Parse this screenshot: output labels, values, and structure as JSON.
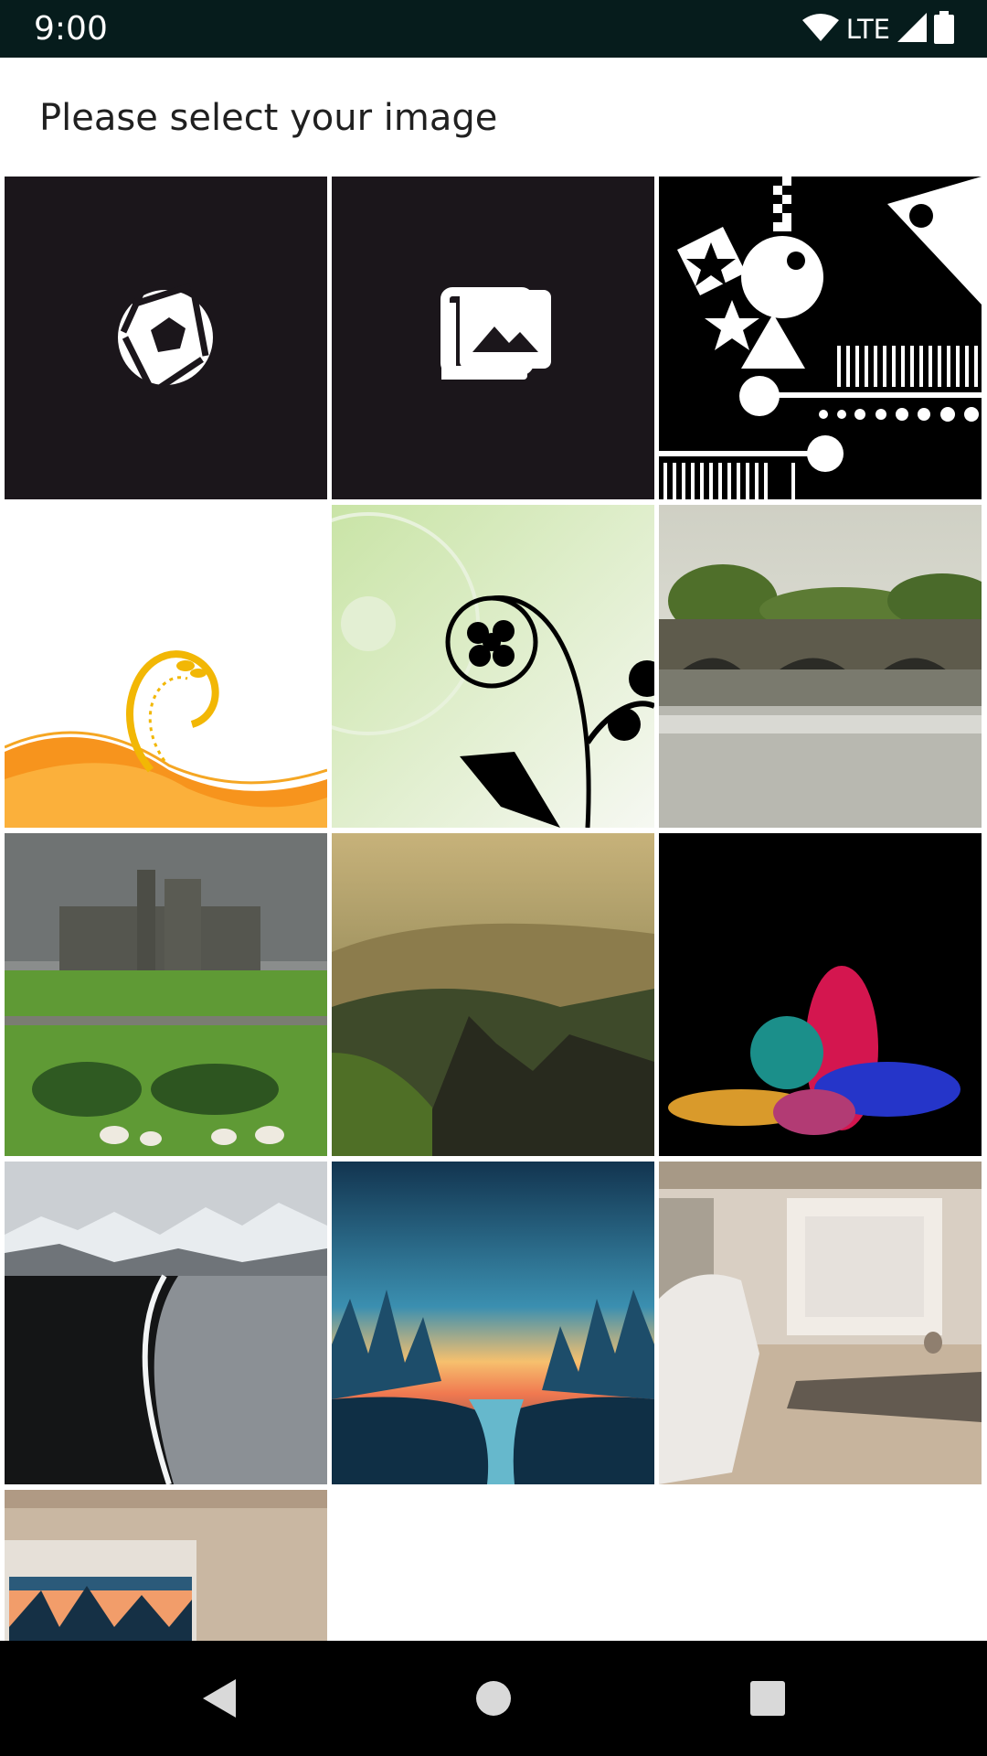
{
  "status_bar": {
    "time": "9:00",
    "network_label": "LTE",
    "icons": [
      "wifi-icon",
      "cell-signal-icon",
      "battery-icon"
    ]
  },
  "header": {
    "title": "Please select your image"
  },
  "grid": {
    "items": [
      {
        "kind": "action",
        "icon": "camera-shutter-icon",
        "name": "camera-tile"
      },
      {
        "kind": "action",
        "icon": "photo-library-icon",
        "name": "gallery-tile"
      },
      {
        "kind": "image",
        "name": "image-geometric-shapes"
      },
      {
        "kind": "image",
        "name": "image-orange-swirl"
      },
      {
        "kind": "image",
        "name": "image-floral-swirl"
      },
      {
        "kind": "image",
        "name": "image-stone-bridge"
      },
      {
        "kind": "image",
        "name": "image-castle-sheep"
      },
      {
        "kind": "image",
        "name": "image-mountain-valley"
      },
      {
        "kind": "image",
        "name": "image-color-powder"
      },
      {
        "kind": "image",
        "name": "image-black-beach"
      },
      {
        "kind": "image",
        "name": "image-forest-sunset"
      },
      {
        "kind": "image",
        "name": "image-room-dog"
      },
      {
        "kind": "image",
        "name": "image-room-painting"
      }
    ]
  },
  "colors": {
    "status_bar": "#061c1c",
    "action_tile": "#1b161b",
    "nav_bar": "#000000",
    "title_text": "#202020"
  },
  "nav_bar": {
    "buttons": [
      "back-icon",
      "home-icon",
      "recents-icon"
    ]
  }
}
